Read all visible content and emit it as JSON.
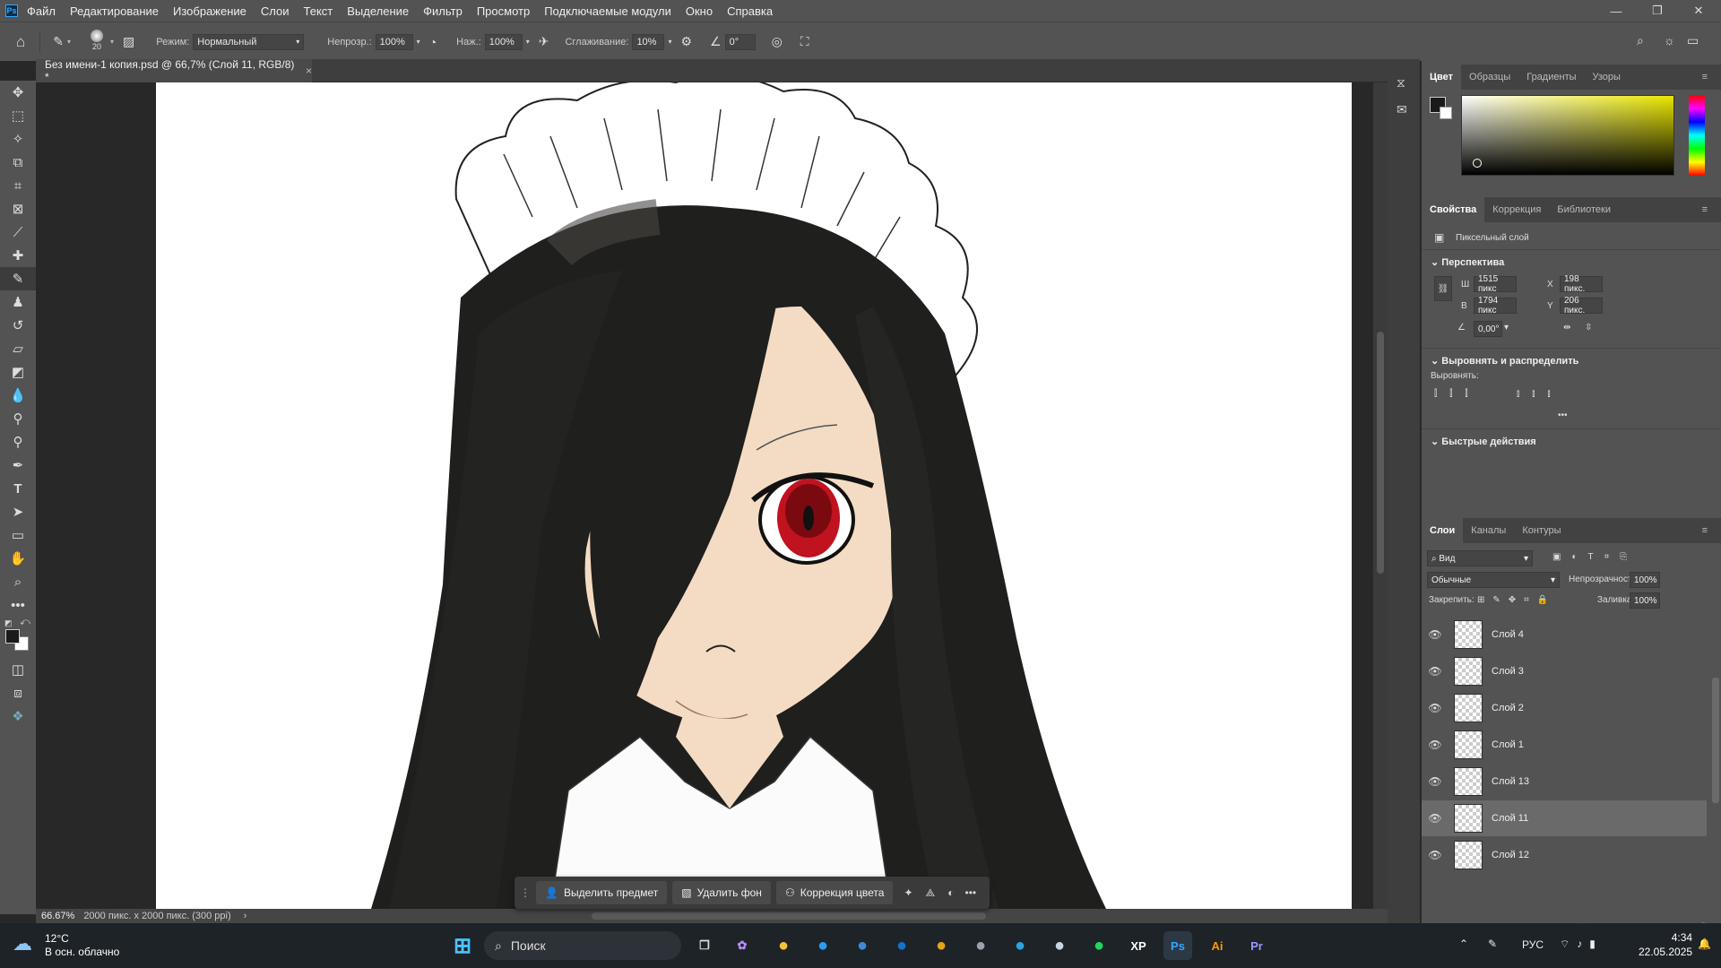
{
  "app": {
    "name": "Photoshop",
    "icon": "ps-app-icon"
  },
  "menu": [
    "Файл",
    "Редактирование",
    "Изображение",
    "Слои",
    "Текст",
    "Выделение",
    "Фильтр",
    "Просмотр",
    "Подключаемые модули",
    "Окно",
    "Справка"
  ],
  "options": {
    "brush_size": "20",
    "mode_label": "Режим:",
    "mode_value": "Нормальный",
    "opacity_label": "Непрозр.:",
    "opacity_value": "100%",
    "pressure_label": "Наж.:",
    "pressure_value": "100%",
    "smoothing_label": "Сглаживание:",
    "smoothing_value": "10%",
    "angle_value": "0°"
  },
  "document": {
    "tab_title": "Без имени-1 копия.psd @ 66,7% (Слой 11, RGB/8) *",
    "close": "×"
  },
  "status": {
    "zoom": "66.67%",
    "info": "2000 пикс. x 2000 пикс. (300 ppi)",
    "arrow": "›"
  },
  "color_panel": {
    "tabs": [
      "Цвет",
      "Образцы",
      "Градиенты",
      "Узоры"
    ],
    "active": 0,
    "hue_color": "#e9e600"
  },
  "properties_panel": {
    "tabs": [
      "Свойства",
      "Коррекция",
      "Библиотеки"
    ],
    "active": 0,
    "layer_type": "Пиксельный слой",
    "perspective_title": "Перспектива",
    "w_label": "Ш",
    "w_value": "1515 пикс",
    "h_label": "В",
    "h_value": "1794 пикс",
    "x_label": "X",
    "x_value": "198 пикс.",
    "y_label": "Y",
    "y_value": "206 пикс.",
    "angle_value": "0,00°",
    "align_title": "Выровнять и распределить",
    "align_label": "Выровнять:",
    "more": "•••",
    "quick_title": "Быстрые действия"
  },
  "layers_panel": {
    "tabs": [
      "Слои",
      "Каналы",
      "Контуры"
    ],
    "active": 0,
    "filter_label": "Вид",
    "blend": "Обычные",
    "opacity_label": "Непрозрачность:",
    "opacity_value": "100%",
    "lock_label": "Закрепить:",
    "fill_label": "Заливка:",
    "fill_value": "100%",
    "layers": [
      {
        "name": "Слой 4",
        "selected": false
      },
      {
        "name": "Слой 3",
        "selected": false
      },
      {
        "name": "Слой 2",
        "selected": false
      },
      {
        "name": "Слой 1",
        "selected": false
      },
      {
        "name": "Слой 13",
        "selected": false
      },
      {
        "name": "Слой 11",
        "selected": true
      },
      {
        "name": "Слой 12",
        "selected": false
      }
    ]
  },
  "context_bar": {
    "select_subject": "Выделить предмет",
    "remove_bg": "Удалить фон",
    "color_correction": "Коррекция цвета",
    "more": "•••"
  },
  "taskbar": {
    "weather_temp": "12°C",
    "weather_desc": "В осн. облачно",
    "search": "Поиск",
    "lang": "РУС",
    "time": "4:34",
    "date": "22.05.2025",
    "apps": [
      {
        "label": "",
        "icon": "file-explorer-icon",
        "color": "#f3c13a"
      },
      {
        "label": "",
        "icon": "edge-icon",
        "color": "#2a9df4"
      },
      {
        "label": "",
        "icon": "store-icon",
        "color": "#3c8bd9"
      },
      {
        "label": "",
        "icon": "outlook-icon",
        "color": "#1273c9"
      },
      {
        "label": "",
        "icon": "chrome-icon",
        "color": "#e3a21a"
      },
      {
        "label": "",
        "icon": "steam-alt-icon",
        "color": "#9aa4ae"
      },
      {
        "label": "",
        "icon": "telegram-icon",
        "color": "#2aa3df"
      },
      {
        "label": "",
        "icon": "steam-icon",
        "color": "#c7d5e0"
      },
      {
        "label": "",
        "icon": "spotify-icon",
        "color": "#1ed760"
      },
      {
        "label": "XP",
        "icon": "xppen-icon",
        "color": "#ffffff"
      },
      {
        "label": "Ps",
        "icon": "photoshop-icon",
        "color": "#31a8ff"
      },
      {
        "label": "Ai",
        "icon": "illustrator-icon",
        "color": "#ff9a00"
      },
      {
        "label": "Pr",
        "icon": "premiere-icon",
        "color": "#9999ff"
      }
    ]
  }
}
